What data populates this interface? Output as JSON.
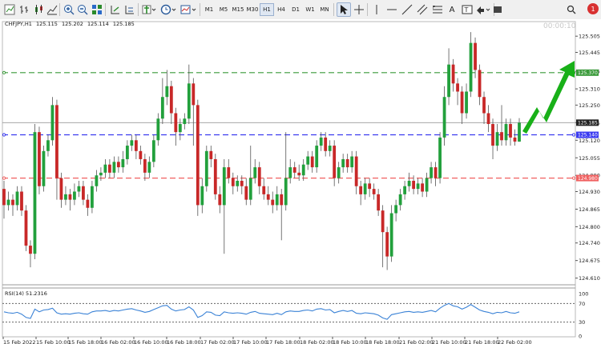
{
  "toolbar": {
    "timeframes": [
      "M1",
      "M5",
      "M15",
      "M30",
      "H1",
      "H4",
      "D1",
      "W1",
      "MN"
    ],
    "active_timeframe": "H1",
    "tools_text": {
      "text_tool": "A"
    },
    "notification_count": "1"
  },
  "chart": {
    "header": {
      "symbol": "CHFJPY,H1",
      "open": "125.115",
      "high": "125.202",
      "low": "125.114",
      "close": "125.185"
    },
    "countdown": "00:00:10",
    "colors": {
      "bull": "#22a03c",
      "bear": "#c82828",
      "wick": "#555555",
      "green_line": "#3a9a3a",
      "blue_line": "#3a3af0",
      "red_line": "#f06060",
      "arrow": "#18b018",
      "rsi": "#3a82d6"
    },
    "price_levels": {
      "green": {
        "value": 125.37,
        "label": "125.370"
      },
      "blue": {
        "value": 125.14,
        "label": "125.140"
      },
      "red": {
        "value": 124.98,
        "label": "124.980"
      },
      "current": {
        "value": 125.185,
        "label": "125.185"
      }
    }
  },
  "chart_data": {
    "type": "candlestick",
    "symbol": "CHFJPY,H1",
    "y_range": [
      124.6,
      125.55
    ],
    "price_ticks": [
      "125.505",
      "125.445",
      "125.375",
      "125.310",
      "125.250",
      "125.185",
      "125.120",
      "125.055",
      "124.990",
      "124.930",
      "124.865",
      "124.800",
      "124.740",
      "124.675",
      "124.610"
    ],
    "date_ticks": [
      "15 Feb 2022",
      "15 Feb 10:00",
      "15 Feb 18:00",
      "16 Feb 02:00",
      "16 Feb 10:00",
      "16 Feb 18:00",
      "17 Feb 02:00",
      "17 Feb 10:00",
      "17 Feb 18:00",
      "18 Feb 02:00",
      "18 Feb 10:00",
      "18 Feb 18:00",
      "21 Feb 02:00",
      "21 Feb 10:00",
      "21 Feb 18:00",
      "22 Feb 02:00"
    ],
    "bars": [
      [
        124.94,
        124.88,
        124.97,
        124.83
      ],
      [
        124.88,
        124.9,
        124.93,
        124.86
      ],
      [
        124.9,
        124.88,
        124.92,
        124.84
      ],
      [
        124.88,
        124.93,
        124.95,
        124.86
      ],
      [
        124.93,
        124.86,
        124.95,
        124.84
      ],
      [
        124.86,
        124.73,
        124.88,
        124.71
      ],
      [
        124.73,
        124.7,
        124.75,
        124.65
      ],
      [
        124.7,
        125.15,
        125.18,
        124.68
      ],
      [
        125.15,
        124.95,
        125.17,
        124.92
      ],
      [
        124.95,
        125.08,
        125.1,
        124.93
      ],
      [
        125.08,
        125.12,
        125.14,
        125.06
      ],
      [
        125.12,
        125.25,
        125.28,
        125.1
      ],
      [
        125.25,
        124.98,
        125.27,
        124.9
      ],
      [
        124.98,
        124.9,
        125.0,
        124.87
      ],
      [
        124.9,
        124.92,
        124.95,
        124.88
      ],
      [
        124.92,
        124.9,
        124.94,
        124.86
      ],
      [
        124.9,
        124.93,
        124.96,
        124.88
      ],
      [
        124.93,
        124.95,
        124.97,
        124.91
      ],
      [
        124.95,
        124.9,
        124.97,
        124.88
      ],
      [
        124.9,
        124.87,
        124.92,
        124.84
      ],
      [
        124.87,
        124.95,
        124.97,
        124.85
      ],
      [
        124.95,
        124.99,
        125.01,
        124.93
      ],
      [
        124.99,
        125.0,
        125.02,
        124.97
      ],
      [
        125.0,
        125.03,
        125.05,
        124.98
      ],
      [
        125.03,
        125.0,
        125.05,
        124.98
      ],
      [
        125.0,
        125.04,
        125.06,
        124.98
      ],
      [
        125.04,
        125.02,
        125.06,
        125.0
      ],
      [
        125.02,
        125.05,
        125.08,
        125.0
      ],
      [
        125.05,
        125.1,
        125.12,
        125.03
      ],
      [
        125.1,
        125.12,
        125.14,
        125.08
      ],
      [
        125.12,
        125.08,
        125.14,
        125.05
      ],
      [
        125.08,
        125.05,
        125.1,
        125.03
      ],
      [
        125.05,
        125.0,
        125.07,
        124.97
      ],
      [
        125.0,
        125.04,
        125.06,
        124.98
      ],
      [
        125.04,
        125.12,
        125.14,
        125.02
      ],
      [
        125.12,
        125.2,
        125.22,
        125.1
      ],
      [
        125.2,
        125.28,
        125.35,
        125.18
      ],
      [
        125.28,
        125.32,
        125.38,
        125.25
      ],
      [
        125.32,
        125.22,
        125.34,
        125.18
      ],
      [
        125.22,
        125.15,
        125.24,
        125.1
      ],
      [
        125.15,
        125.18,
        125.2,
        125.12
      ],
      [
        125.18,
        125.2,
        125.22,
        125.16
      ],
      [
        125.2,
        125.33,
        125.4,
        125.18
      ],
      [
        125.33,
        125.25,
        125.35,
        125.1
      ],
      [
        125.25,
        124.88,
        125.27,
        124.84
      ],
      [
        124.88,
        124.95,
        124.98,
        124.85
      ],
      [
        124.95,
        125.08,
        125.1,
        124.93
      ],
      [
        125.08,
        125.05,
        125.1,
        125.02
      ],
      [
        125.05,
        124.92,
        125.07,
        124.9
      ],
      [
        124.92,
        124.88,
        124.95,
        124.85
      ],
      [
        124.88,
        125.02,
        125.05,
        124.7
      ],
      [
        125.02,
        124.98,
        125.05,
        124.96
      ],
      [
        124.98,
        124.95,
        125.0,
        124.92
      ],
      [
        124.95,
        124.97,
        124.99,
        124.93
      ],
      [
        124.97,
        124.95,
        124.99,
        124.92
      ],
      [
        124.95,
        124.9,
        124.98,
        124.88
      ],
      [
        124.9,
        124.98,
        125.1,
        124.88
      ],
      [
        124.98,
        125.02,
        125.05,
        124.96
      ],
      [
        125.02,
        124.95,
        125.04,
        124.92
      ],
      [
        124.95,
        124.92,
        124.98,
        124.9
      ],
      [
        124.92,
        124.9,
        124.95,
        124.88
      ],
      [
        124.9,
        124.88,
        124.93,
        124.85
      ],
      [
        124.88,
        124.92,
        124.95,
        124.86
      ],
      [
        124.92,
        124.88,
        124.94,
        124.75
      ],
      [
        124.88,
        124.98,
        125.15,
        124.86
      ],
      [
        124.98,
        125.02,
        125.05,
        124.96
      ],
      [
        125.02,
        125.0,
        125.04,
        124.98
      ],
      [
        125.0,
        124.99,
        125.03,
        124.97
      ],
      [
        124.99,
        125.03,
        125.05,
        124.97
      ],
      [
        125.03,
        125.06,
        125.08,
        125.01
      ],
      [
        125.06,
        125.02,
        125.08,
        125.0
      ],
      [
        125.02,
        125.1,
        125.12,
        125.0
      ],
      [
        125.1,
        125.13,
        125.15,
        125.08
      ],
      [
        125.13,
        125.08,
        125.15,
        125.06
      ],
      [
        125.08,
        125.1,
        125.12,
        125.06
      ],
      [
        125.1,
        124.98,
        125.12,
        124.95
      ],
      [
        124.98,
        125.02,
        125.04,
        124.96
      ],
      [
        125.02,
        125.05,
        125.07,
        125.0
      ],
      [
        125.05,
        125.02,
        125.07,
        125.0
      ],
      [
        125.02,
        125.06,
        125.08,
        125.0
      ],
      [
        125.06,
        124.95,
        125.08,
        124.92
      ],
      [
        124.95,
        124.92,
        124.97,
        124.88
      ],
      [
        124.92,
        124.96,
        124.98,
        124.9
      ],
      [
        124.96,
        124.94,
        124.98,
        124.91
      ],
      [
        124.94,
        124.92,
        124.96,
        124.9
      ],
      [
        124.92,
        124.86,
        124.94,
        124.84
      ],
      [
        124.86,
        124.78,
        124.88,
        124.65
      ],
      [
        124.78,
        124.69,
        124.8,
        124.64
      ],
      [
        124.69,
        124.85,
        124.88,
        124.67
      ],
      [
        124.85,
        124.88,
        124.9,
        124.82
      ],
      [
        124.88,
        124.92,
        124.94,
        124.86
      ],
      [
        124.92,
        124.95,
        124.97,
        124.9
      ],
      [
        124.95,
        124.97,
        125.0,
        124.93
      ],
      [
        124.97,
        124.94,
        124.99,
        124.92
      ],
      [
        124.94,
        124.96,
        124.98,
        124.92
      ],
      [
        124.96,
        124.93,
        124.98,
        124.91
      ],
      [
        124.93,
        124.98,
        125.0,
        124.91
      ],
      [
        124.98,
        125.02,
        125.04,
        124.96
      ],
      [
        125.02,
        124.98,
        125.04,
        124.95
      ],
      [
        124.98,
        125.13,
        125.15,
        124.96
      ],
      [
        125.13,
        125.28,
        125.32,
        125.1
      ],
      [
        125.28,
        125.4,
        125.46,
        125.25
      ],
      [
        125.4,
        125.33,
        125.42,
        125.3
      ],
      [
        125.33,
        125.3,
        125.35,
        125.25
      ],
      [
        125.3,
        125.22,
        125.32,
        125.18
      ],
      [
        125.22,
        125.3,
        125.33,
        125.2
      ],
      [
        125.3,
        125.48,
        125.52,
        125.28
      ],
      [
        125.48,
        125.38,
        125.5,
        125.35
      ],
      [
        125.38,
        125.28,
        125.4,
        125.25
      ],
      [
        125.28,
        125.22,
        125.3,
        125.18
      ],
      [
        125.22,
        125.18,
        125.25,
        125.15
      ],
      [
        125.18,
        125.1,
        125.2,
        125.05
      ],
      [
        125.1,
        125.15,
        125.18,
        125.08
      ],
      [
        125.15,
        125.12,
        125.25,
        125.1
      ],
      [
        125.12,
        125.18,
        125.2,
        125.1
      ],
      [
        125.18,
        125.13,
        125.2,
        125.1
      ],
      [
        125.13,
        125.115,
        125.16,
        125.1
      ],
      [
        125.115,
        125.185,
        125.202,
        125.114
      ]
    ],
    "rsi": {
      "label": "RSI(14) 51.2316",
      "levels": [
        "70",
        "30"
      ],
      "scale_labels": [
        "100",
        "70",
        "30",
        "0"
      ],
      "values": [
        52,
        50,
        49,
        51,
        47,
        40,
        38,
        58,
        52,
        56,
        57,
        60,
        50,
        47,
        48,
        47,
        49,
        50,
        48,
        47,
        52,
        54,
        54,
        55,
        53,
        55,
        54,
        56,
        58,
        59,
        56,
        54,
        51,
        53,
        57,
        61,
        65,
        66,
        58,
        54,
        56,
        57,
        63,
        56,
        40,
        44,
        52,
        51,
        45,
        44,
        52,
        50,
        49,
        50,
        49,
        47,
        51,
        53,
        49,
        48,
        47,
        46,
        49,
        46,
        52,
        54,
        53,
        53,
        55,
        56,
        54,
        58,
        59,
        56,
        57,
        50,
        53,
        55,
        53,
        55,
        49,
        48,
        50,
        49,
        48,
        45,
        39,
        36,
        46,
        48,
        50,
        52,
        53,
        51,
        52,
        51,
        53,
        55,
        52,
        60,
        66,
        70,
        65,
        63,
        58,
        62,
        68,
        62,
        56,
        53,
        51,
        48,
        51,
        50,
        53,
        50,
        49,
        52
      ]
    }
  }
}
